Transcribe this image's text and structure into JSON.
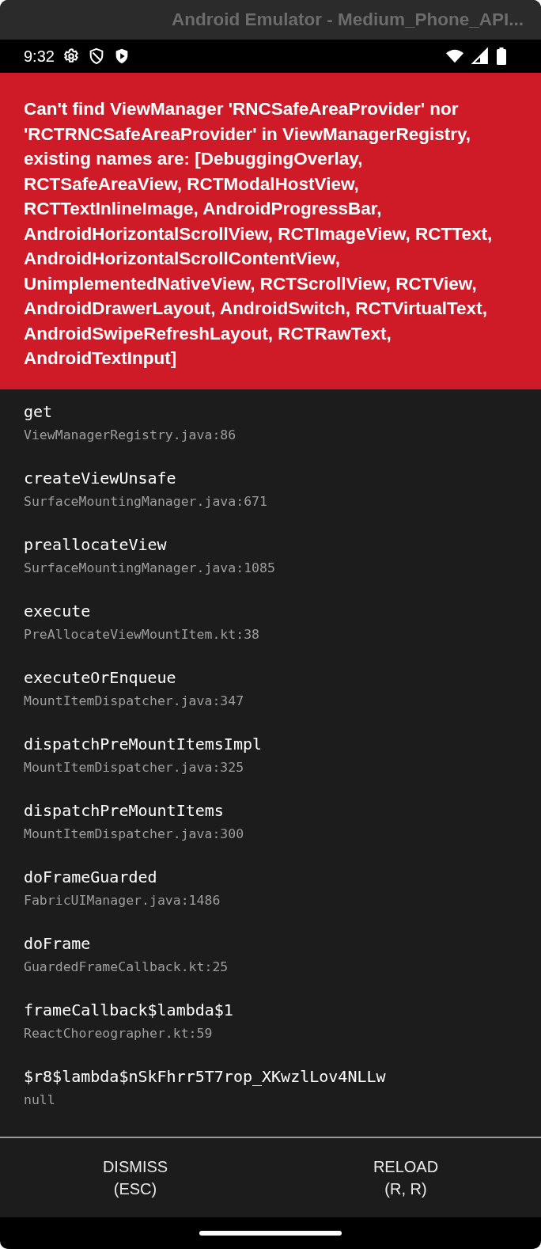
{
  "window": {
    "title": "Android Emulator - Medium_Phone_API..."
  },
  "status_bar": {
    "time": "9:32"
  },
  "error": {
    "message": "Can't find ViewManager 'RNCSafeAreaProvider' nor 'RCTRNCSafeAreaProvider' in ViewManagerRegistry, existing names are: [DebuggingOverlay, RCTSafeAreaView, RCTModalHostView, RCTTextInlineImage, AndroidProgressBar, AndroidHorizontalScrollView, RCTImageView, RCTText, AndroidHorizontalScrollContentView, UnimplementedNativeView, RCTScrollView, RCTView, AndroidDrawerLayout, AndroidSwitch, RCTVirtualText, AndroidSwipeRefreshLayout, RCTRawText, AndroidTextInput]"
  },
  "stack": [
    {
      "method": "get",
      "file": "ViewManagerRegistry.java:86"
    },
    {
      "method": "createViewUnsafe",
      "file": "SurfaceMountingManager.java:671"
    },
    {
      "method": "preallocateView",
      "file": "SurfaceMountingManager.java:1085"
    },
    {
      "method": "execute",
      "file": "PreAllocateViewMountItem.kt:38"
    },
    {
      "method": "executeOrEnqueue",
      "file": "MountItemDispatcher.java:347"
    },
    {
      "method": "dispatchPreMountItemsImpl",
      "file": "MountItemDispatcher.java:325"
    },
    {
      "method": "dispatchPreMountItems",
      "file": "MountItemDispatcher.java:300"
    },
    {
      "method": "doFrameGuarded",
      "file": "FabricUIManager.java:1486"
    },
    {
      "method": "doFrame",
      "file": "GuardedFrameCallback.kt:25"
    },
    {
      "method": "frameCallback$lambda$1",
      "file": "ReactChoreographer.kt:59"
    },
    {
      "method": "$r8$lambda$nSkFhrr5T7rop_XKwzlLov4NLLw",
      "file": "null"
    }
  ],
  "buttons": [
    {
      "label": "DISMISS",
      "shortcut": "(ESC)"
    },
    {
      "label": "RELOAD",
      "shortcut": "(R, R)"
    }
  ]
}
